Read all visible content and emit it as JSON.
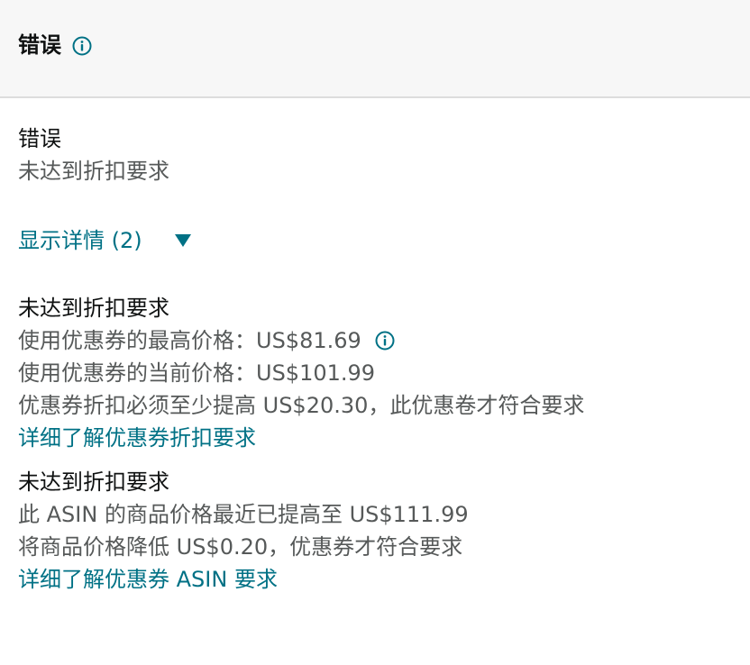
{
  "header": {
    "title": "错误",
    "info_icon": "info-icon",
    "accent_color": "#007185"
  },
  "summary": {
    "label": "错误",
    "message": "未达到折扣要求"
  },
  "details_toggle": {
    "label": "显示详情 (2)",
    "icon": "caret-down-icon"
  },
  "details": [
    {
      "title": "未达到折扣要求",
      "lines": [
        "使用优惠券的最高价格：US$81.69",
        "使用优惠券的当前价格：US$101.99",
        "优惠券折扣必须至少提高 US$20.30，此优惠卷才符合要求"
      ],
      "link": "详细了解优惠券折扣要求"
    },
    {
      "title": "未达到折扣要求",
      "lines": [
        "此 ASIN 的商品价格最近已提高至 US$111.99",
        "将商品价格降低 US$0.20，优惠券才符合要求"
      ],
      "link": "详细了解优惠券 ASIN 要求"
    }
  ]
}
